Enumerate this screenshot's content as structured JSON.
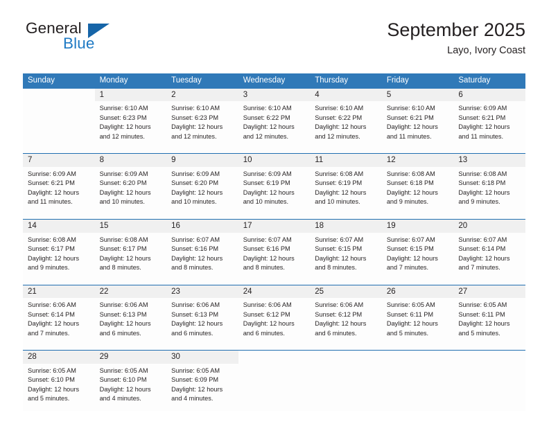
{
  "brand": {
    "name_part1": "General",
    "name_part2": "Blue",
    "flag_icon": "blue-triangle-flag-icon"
  },
  "header": {
    "title": "September 2025",
    "subtitle": "Layo, Ivory Coast"
  },
  "colors": {
    "header_blue": "#3079b8",
    "separator_blue": "#1f6eb0",
    "daynum_gray": "#f0f0f0",
    "brand_blue": "#1f7ac4",
    "text": "#231f20"
  },
  "weekday_headers": [
    "Sunday",
    "Monday",
    "Tuesday",
    "Wednesday",
    "Thursday",
    "Friday",
    "Saturday"
  ],
  "weeks": [
    [
      {
        "day": "",
        "lines": []
      },
      {
        "day": "1",
        "lines": [
          "Sunrise: 6:10 AM",
          "Sunset: 6:23 PM",
          "Daylight: 12 hours",
          "and 12 minutes."
        ]
      },
      {
        "day": "2",
        "lines": [
          "Sunrise: 6:10 AM",
          "Sunset: 6:23 PM",
          "Daylight: 12 hours",
          "and 12 minutes."
        ]
      },
      {
        "day": "3",
        "lines": [
          "Sunrise: 6:10 AM",
          "Sunset: 6:22 PM",
          "Daylight: 12 hours",
          "and 12 minutes."
        ]
      },
      {
        "day": "4",
        "lines": [
          "Sunrise: 6:10 AM",
          "Sunset: 6:22 PM",
          "Daylight: 12 hours",
          "and 12 minutes."
        ]
      },
      {
        "day": "5",
        "lines": [
          "Sunrise: 6:10 AM",
          "Sunset: 6:21 PM",
          "Daylight: 12 hours",
          "and 11 minutes."
        ]
      },
      {
        "day": "6",
        "lines": [
          "Sunrise: 6:09 AM",
          "Sunset: 6:21 PM",
          "Daylight: 12 hours",
          "and 11 minutes."
        ]
      }
    ],
    [
      {
        "day": "7",
        "lines": [
          "Sunrise: 6:09 AM",
          "Sunset: 6:21 PM",
          "Daylight: 12 hours",
          "and 11 minutes."
        ]
      },
      {
        "day": "8",
        "lines": [
          "Sunrise: 6:09 AM",
          "Sunset: 6:20 PM",
          "Daylight: 12 hours",
          "and 10 minutes."
        ]
      },
      {
        "day": "9",
        "lines": [
          "Sunrise: 6:09 AM",
          "Sunset: 6:20 PM",
          "Daylight: 12 hours",
          "and 10 minutes."
        ]
      },
      {
        "day": "10",
        "lines": [
          "Sunrise: 6:09 AM",
          "Sunset: 6:19 PM",
          "Daylight: 12 hours",
          "and 10 minutes."
        ]
      },
      {
        "day": "11",
        "lines": [
          "Sunrise: 6:08 AM",
          "Sunset: 6:19 PM",
          "Daylight: 12 hours",
          "and 10 minutes."
        ]
      },
      {
        "day": "12",
        "lines": [
          "Sunrise: 6:08 AM",
          "Sunset: 6:18 PM",
          "Daylight: 12 hours",
          "and 9 minutes."
        ]
      },
      {
        "day": "13",
        "lines": [
          "Sunrise: 6:08 AM",
          "Sunset: 6:18 PM",
          "Daylight: 12 hours",
          "and 9 minutes."
        ]
      }
    ],
    [
      {
        "day": "14",
        "lines": [
          "Sunrise: 6:08 AM",
          "Sunset: 6:17 PM",
          "Daylight: 12 hours",
          "and 9 minutes."
        ]
      },
      {
        "day": "15",
        "lines": [
          "Sunrise: 6:08 AM",
          "Sunset: 6:17 PM",
          "Daylight: 12 hours",
          "and 8 minutes."
        ]
      },
      {
        "day": "16",
        "lines": [
          "Sunrise: 6:07 AM",
          "Sunset: 6:16 PM",
          "Daylight: 12 hours",
          "and 8 minutes."
        ]
      },
      {
        "day": "17",
        "lines": [
          "Sunrise: 6:07 AM",
          "Sunset: 6:16 PM",
          "Daylight: 12 hours",
          "and 8 minutes."
        ]
      },
      {
        "day": "18",
        "lines": [
          "Sunrise: 6:07 AM",
          "Sunset: 6:15 PM",
          "Daylight: 12 hours",
          "and 8 minutes."
        ]
      },
      {
        "day": "19",
        "lines": [
          "Sunrise: 6:07 AM",
          "Sunset: 6:15 PM",
          "Daylight: 12 hours",
          "and 7 minutes."
        ]
      },
      {
        "day": "20",
        "lines": [
          "Sunrise: 6:07 AM",
          "Sunset: 6:14 PM",
          "Daylight: 12 hours",
          "and 7 minutes."
        ]
      }
    ],
    [
      {
        "day": "21",
        "lines": [
          "Sunrise: 6:06 AM",
          "Sunset: 6:14 PM",
          "Daylight: 12 hours",
          "and 7 minutes."
        ]
      },
      {
        "day": "22",
        "lines": [
          "Sunrise: 6:06 AM",
          "Sunset: 6:13 PM",
          "Daylight: 12 hours",
          "and 6 minutes."
        ]
      },
      {
        "day": "23",
        "lines": [
          "Sunrise: 6:06 AM",
          "Sunset: 6:13 PM",
          "Daylight: 12 hours",
          "and 6 minutes."
        ]
      },
      {
        "day": "24",
        "lines": [
          "Sunrise: 6:06 AM",
          "Sunset: 6:12 PM",
          "Daylight: 12 hours",
          "and 6 minutes."
        ]
      },
      {
        "day": "25",
        "lines": [
          "Sunrise: 6:06 AM",
          "Sunset: 6:12 PM",
          "Daylight: 12 hours",
          "and 6 minutes."
        ]
      },
      {
        "day": "26",
        "lines": [
          "Sunrise: 6:05 AM",
          "Sunset: 6:11 PM",
          "Daylight: 12 hours",
          "and 5 minutes."
        ]
      },
      {
        "day": "27",
        "lines": [
          "Sunrise: 6:05 AM",
          "Sunset: 6:11 PM",
          "Daylight: 12 hours",
          "and 5 minutes."
        ]
      }
    ],
    [
      {
        "day": "28",
        "lines": [
          "Sunrise: 6:05 AM",
          "Sunset: 6:10 PM",
          "Daylight: 12 hours",
          "and 5 minutes."
        ]
      },
      {
        "day": "29",
        "lines": [
          "Sunrise: 6:05 AM",
          "Sunset: 6:10 PM",
          "Daylight: 12 hours",
          "and 4 minutes."
        ]
      },
      {
        "day": "30",
        "lines": [
          "Sunrise: 6:05 AM",
          "Sunset: 6:09 PM",
          "Daylight: 12 hours",
          "and 4 minutes."
        ]
      },
      {
        "day": "",
        "lines": []
      },
      {
        "day": "",
        "lines": []
      },
      {
        "day": "",
        "lines": []
      },
      {
        "day": "",
        "lines": []
      }
    ]
  ]
}
